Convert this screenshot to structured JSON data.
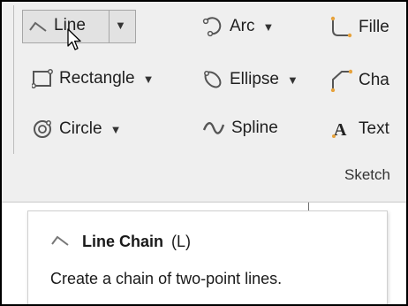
{
  "ribbon": {
    "commands": {
      "line": {
        "label": "Line",
        "icon": "line-icon"
      },
      "arc": {
        "label": "Arc",
        "icon": "arc-icon"
      },
      "fillet": {
        "label": "Fille",
        "icon": "fillet-icon"
      },
      "rectangle": {
        "label": "Rectangle",
        "icon": "rectangle-icon"
      },
      "ellipse": {
        "label": "Ellipse",
        "icon": "ellipse-icon"
      },
      "chamfer": {
        "label": "Cha",
        "icon": "chamfer-icon"
      },
      "circle": {
        "label": "Circle",
        "icon": "circle-icon"
      },
      "spline": {
        "label": "Spline",
        "icon": "spline-icon"
      },
      "text": {
        "label": "Text",
        "icon": "text-icon"
      }
    },
    "dropdown_glyph": "▼",
    "group_label": "Sketch"
  },
  "tooltip": {
    "title": "Line Chain",
    "shortcut": "(L)",
    "description": "Create a chain of two-point lines."
  },
  "colors": {
    "ribbon_bg": "#efefef",
    "accent_icon": "#555555",
    "endpoint_accent": "#e6a23c"
  }
}
